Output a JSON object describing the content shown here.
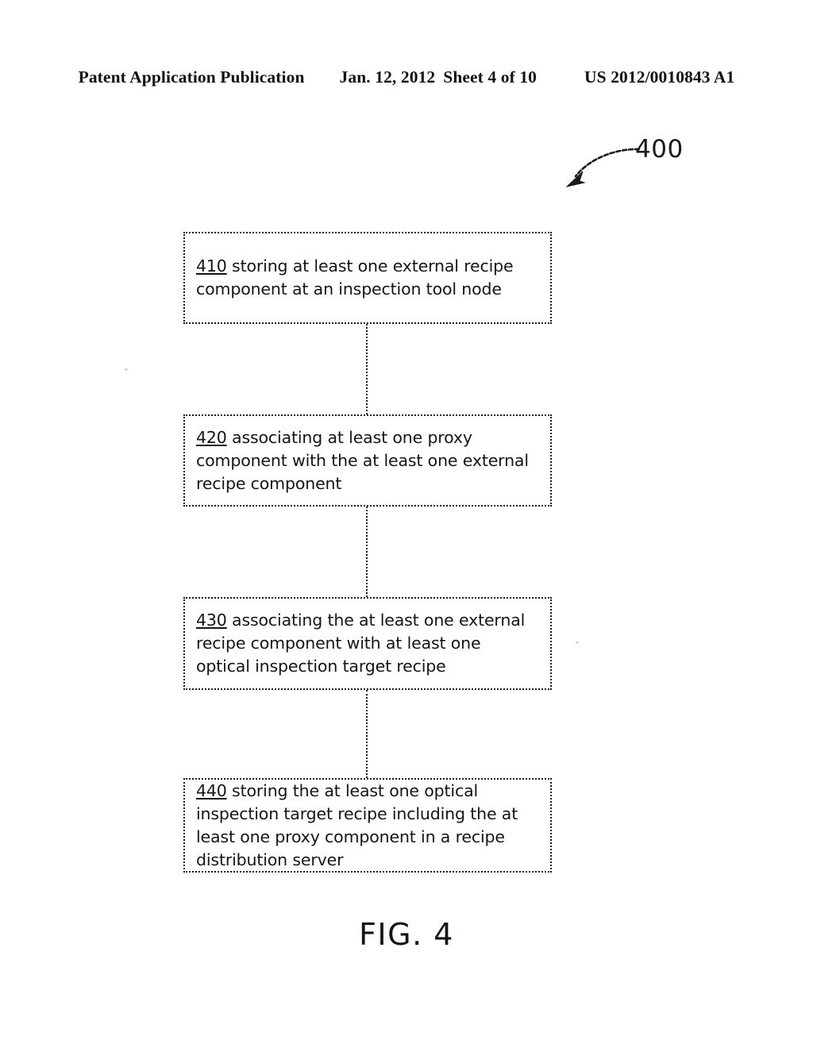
{
  "header": {
    "publication_label": "Patent Application Publication",
    "date": "Jan. 12, 2012",
    "sheet": "Sheet 4 of 10",
    "publication_number": "US 2012/0010843 A1"
  },
  "figure": {
    "caption": "FIG. 4",
    "reference_numeral": "400",
    "ink_color": "#1a1a1a",
    "background_color": "#ffffff",
    "steps": [
      {
        "number": "410",
        "text": " storing at least one external recipe component at an inspection tool node"
      },
      {
        "number": "420",
        "text": " associating at least one proxy component with the at least one external recipe component"
      },
      {
        "number": "430",
        "text": " associating the at least one external recipe component with at least one optical inspection target recipe"
      },
      {
        "number": "440",
        "text": " storing the at least one optical inspection target recipe including the at least one proxy component in a recipe distribution server"
      }
    ]
  }
}
